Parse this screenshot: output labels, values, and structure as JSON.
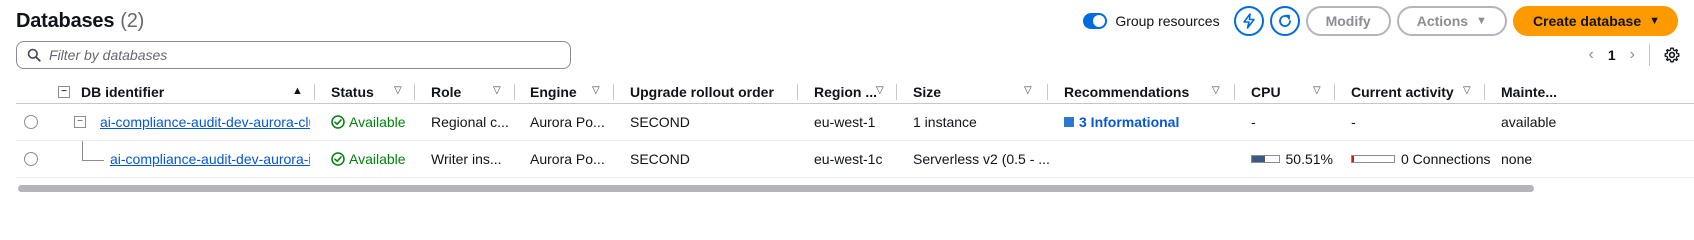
{
  "header": {
    "title": "Databases",
    "count": "(2)",
    "group_resources_label": "Group resources",
    "group_resources_on": true,
    "modify_label": "Modify",
    "actions_label": "Actions",
    "create_label": "Create database"
  },
  "search": {
    "placeholder": "Filter by databases"
  },
  "pagination": {
    "current_page": "1"
  },
  "table": {
    "columns": [
      "DB identifier",
      "Status",
      "Role",
      "Engine",
      "Upgrade rollout order",
      "Region ...",
      "Size",
      "Recommendations",
      "CPU",
      "Current activity",
      "Mainte..."
    ],
    "rows": [
      {
        "identifier": "ai-compliance-audit-dev-aurora-cluster",
        "status": "Available",
        "role": "Regional c...",
        "engine": "Aurora Po...",
        "upgrade_order": "SECOND",
        "region": "eu-west-1",
        "size": "1 instance",
        "recommendations": "3 Informational",
        "cpu": "-",
        "activity": "-",
        "maintenance": "available"
      },
      {
        "identifier": "ai-compliance-audit-dev-aurora-instan",
        "status": "Available",
        "role": "Writer ins...",
        "engine": "Aurora Po...",
        "upgrade_order": "SECOND",
        "region": "eu-west-1c",
        "size": "Serverless v2 (0.5 - ...",
        "recommendations": "",
        "cpu": "50.51%",
        "cpu_fraction": 0.5051,
        "activity": "0 Connections",
        "maintenance": "none"
      }
    ]
  },
  "colors": {
    "primary_button": "#ff9900",
    "link": "#0656d5",
    "available": "#037f0c",
    "toggle": "#006ce0"
  }
}
